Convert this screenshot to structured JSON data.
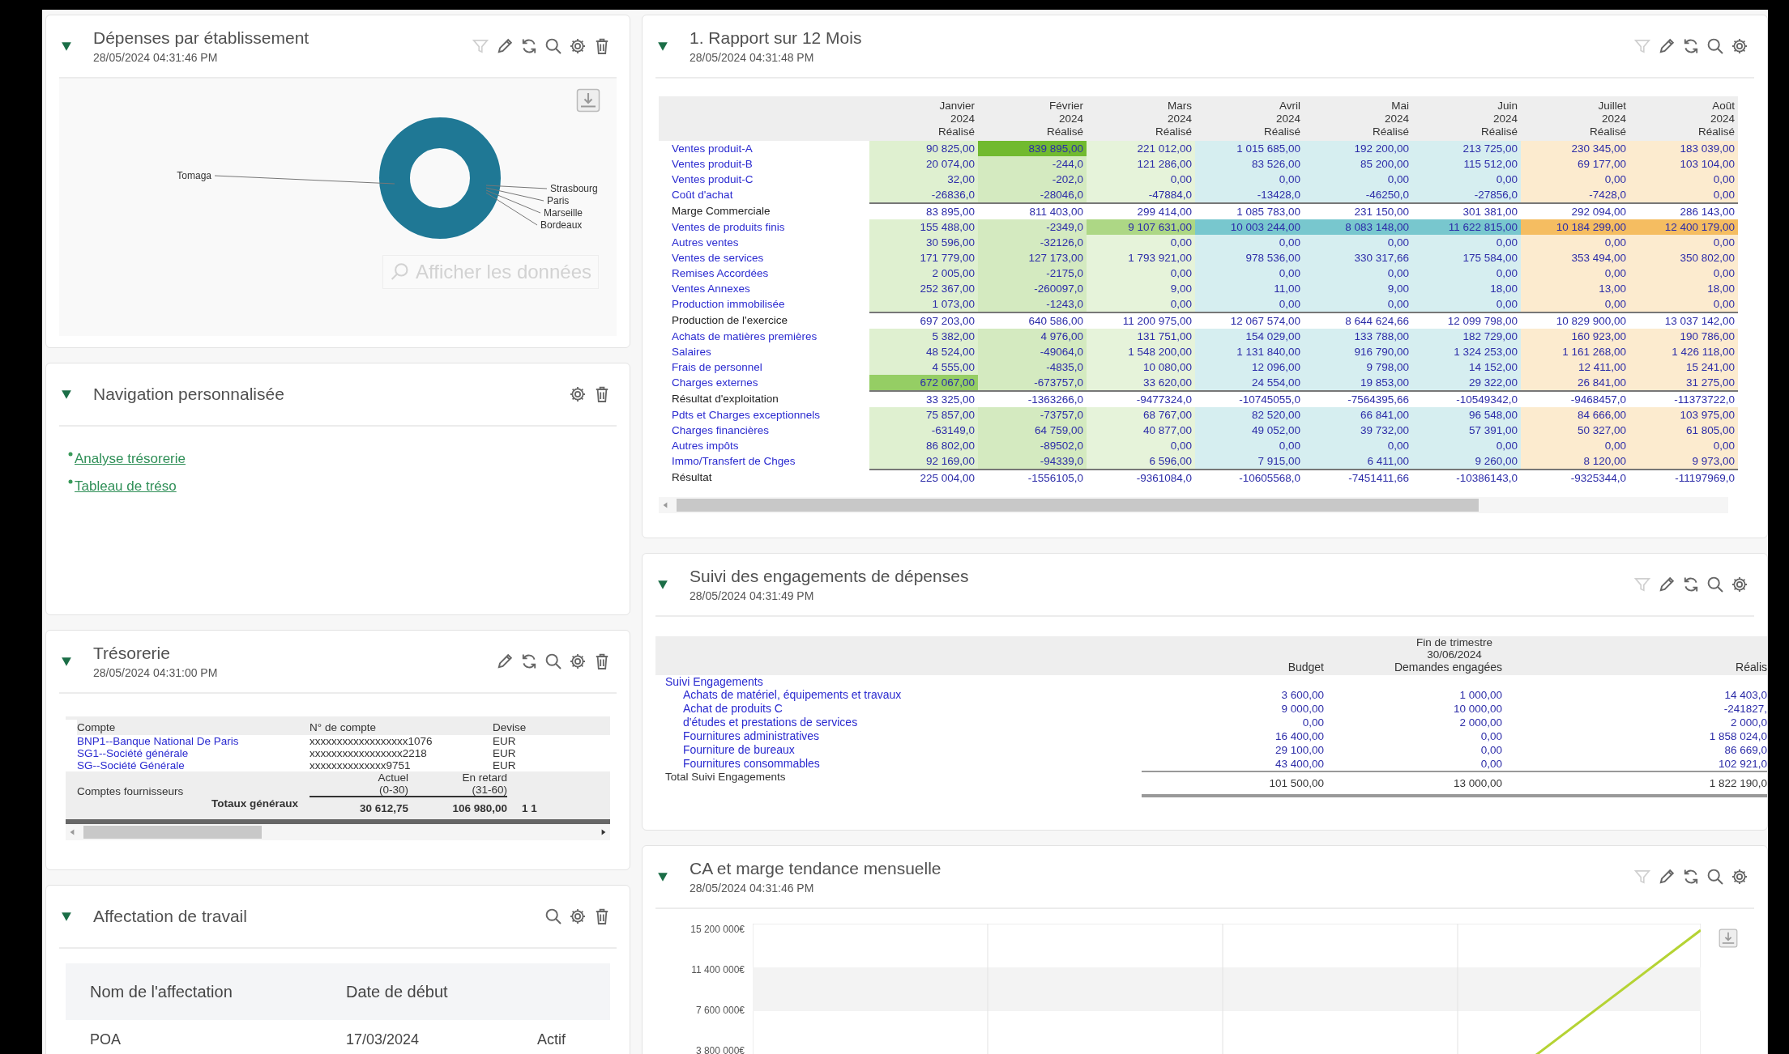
{
  "left": {
    "expenses": {
      "title": "Dépenses par établissement",
      "date": "28/05/2024 04:31:46 PM",
      "tools": [
        {
          "kind": "filter",
          "disabled": true
        },
        {
          "kind": "edit",
          "disabled": false
        },
        {
          "kind": "refresh",
          "disabled": false
        },
        {
          "kind": "search",
          "disabled": false
        },
        {
          "kind": "settings",
          "disabled": false
        },
        {
          "kind": "delete",
          "disabled": false
        }
      ],
      "donut_left_label": "Tomaga",
      "donut_right_labels": [
        "Strasbourg",
        "Paris",
        "Marseille",
        "Bordeaux"
      ],
      "show_data_button": {
        "label": "Afficher les données",
        "disabled": true
      }
    },
    "navigation": {
      "title": "Navigation personnalisée",
      "tools": [
        {
          "kind": "settings",
          "disabled": false
        },
        {
          "kind": "delete",
          "disabled": false
        }
      ],
      "links": [
        "Analyse trésorerie",
        "Tableau de tréso"
      ]
    },
    "treasury": {
      "title": "Trésorerie",
      "date": "28/05/2024 04:31:00 PM",
      "tools": [
        {
          "kind": "edit",
          "disabled": false
        },
        {
          "kind": "refresh",
          "disabled": false
        },
        {
          "kind": "search",
          "disabled": false
        },
        {
          "kind": "settings",
          "disabled": false
        },
        {
          "kind": "delete",
          "disabled": false
        }
      ],
      "columns": [
        "Compte",
        "N° de compte",
        "Devise"
      ],
      "rows": [
        {
          "account": "BNP1--Banque National De Paris",
          "number": "xxxxxxxxxxxxxxxxxx1076",
          "currency": "EUR"
        },
        {
          "account": "SG1--Société générale",
          "number": "xxxxxxxxxxxxxxxxx2218",
          "currency": "EUR"
        },
        {
          "account": "SG--Société Générale",
          "number": "xxxxxxxxxxxxxx9751",
          "currency": "EUR"
        }
      ],
      "suppliers_label": "Comptes fournisseurs",
      "aging_columns": [
        {
          "label": "Actuel",
          "range": "(0-30)"
        },
        {
          "label": "En retard",
          "range": "(31-60)"
        }
      ],
      "totals_label": "Totaux généraux",
      "totals": [
        "30 612,75",
        "106 980,00",
        "1 1"
      ]
    },
    "assignment": {
      "title": "Affectation de travail",
      "tools": [
        {
          "kind": "search",
          "disabled": false
        },
        {
          "kind": "settings",
          "disabled": false
        },
        {
          "kind": "delete",
          "disabled": false
        }
      ],
      "columns": [
        "Nom de l'affectation",
        "Date de début"
      ],
      "rows": [
        {
          "name": "POA",
          "start": "17/03/2024",
          "status": "Actif"
        }
      ]
    }
  },
  "right": {
    "report": {
      "title": "1. Rapport sur 12 Mois",
      "date": "28/05/2024 04:31:48 PM",
      "tools": [
        {
          "kind": "filter",
          "disabled": true
        },
        {
          "kind": "edit",
          "disabled": false
        },
        {
          "kind": "refresh",
          "disabled": false
        },
        {
          "kind": "search",
          "disabled": false
        },
        {
          "kind": "settings",
          "disabled": false
        }
      ],
      "columns": [
        {
          "month": "Janvier",
          "year": "2024",
          "measure": "Réalisé",
          "color": "#dff0d0"
        },
        {
          "month": "Février",
          "year": "2024",
          "measure": "Réalisé",
          "color": "#d4eac0"
        },
        {
          "month": "Mars",
          "year": "2024",
          "measure": "Réalisé",
          "color": "#e6f3da"
        },
        {
          "month": "Avril",
          "year": "2024",
          "measure": "Réalisé",
          "color": "#d6eef0"
        },
        {
          "month": "Mai",
          "year": "2024",
          "measure": "Réalisé",
          "color": "#d6eef0"
        },
        {
          "month": "Juin",
          "year": "2024",
          "measure": "Réalisé",
          "color": "#d6eef0"
        },
        {
          "month": "Juillet",
          "year": "2024",
          "measure": "Réalisé",
          "color": "#fcebcf"
        },
        {
          "month": "Août",
          "year": "2024",
          "measure": "Réalisé",
          "color": "#fcebcf"
        }
      ],
      "rows": [
        {
          "label": "Ventes produit-A",
          "kind": "detail",
          "values": [
            "90 825,00",
            "839 895,00",
            "221 012,00",
            "1 015 685,00",
            "192 200,00",
            "213 725,00",
            "230 345,00",
            "183 039,00"
          ],
          "highlight": [
            false,
            true,
            false,
            false,
            false,
            false,
            false,
            false
          ]
        },
        {
          "label": "Ventes produit-B",
          "kind": "detail",
          "values": [
            "20 074,00",
            "-244,0",
            "121 286,00",
            "83 526,00",
            "85 200,00",
            "115 512,00",
            "69 177,00",
            "103 104,00"
          ],
          "highlight": [
            false,
            false,
            false,
            false,
            false,
            false,
            false,
            false
          ]
        },
        {
          "label": "Ventes produit-C",
          "kind": "detail",
          "values": [
            "32,00",
            "-202,0",
            "0,00",
            "0,00",
            "0,00",
            "0,00",
            "0,00",
            "0,00"
          ],
          "highlight": [
            false,
            false,
            false,
            false,
            false,
            false,
            false,
            false
          ]
        },
        {
          "label": "Coût d'achat",
          "kind": "detail",
          "values": [
            "-26836,0",
            "-28046,0",
            "-47884,0",
            "-13428,0",
            "-46250,0",
            "-27856,0",
            "-7428,0",
            "0,00"
          ],
          "highlight": [
            false,
            false,
            false,
            false,
            false,
            false,
            false,
            false
          ]
        },
        {
          "label": "Marge Commerciale",
          "kind": "total",
          "values": [
            "83 895,00",
            "811 403,00",
            "299 414,00",
            "1 085 783,00",
            "231 150,00",
            "301 381,00",
            "292 094,00",
            "286 143,00"
          ],
          "highlight": [
            false,
            false,
            false,
            false,
            false,
            false,
            false,
            false
          ]
        },
        {
          "label": "Ventes de produits finis",
          "kind": "detail",
          "values": [
            "155 488,00",
            "-2349,0",
            "9 107 631,00",
            "10 003 244,00",
            "8 083 148,00",
            "11 622 815,00",
            "10 184 299,00",
            "12 400 179,00"
          ],
          "highlight": [
            false,
            false,
            true,
            true,
            true,
            true,
            true,
            true
          ]
        },
        {
          "label": "Autres ventes",
          "kind": "detail",
          "values": [
            "30 596,00",
            "-32126,0",
            "0,00",
            "0,00",
            "0,00",
            "0,00",
            "0,00",
            "0,00"
          ],
          "highlight": [
            false,
            false,
            false,
            false,
            false,
            false,
            false,
            false
          ]
        },
        {
          "label": "Ventes de services",
          "kind": "detail",
          "values": [
            "171 779,00",
            "127 173,00",
            "1 793 921,00",
            "978 536,00",
            "330 317,66",
            "175 584,00",
            "353 494,00",
            "350 802,00"
          ],
          "highlight": [
            false,
            false,
            false,
            false,
            false,
            false,
            false,
            false
          ]
        },
        {
          "label": "Remises Accordées",
          "kind": "detail",
          "values": [
            "2 005,00",
            "-2175,0",
            "0,00",
            "0,00",
            "0,00",
            "0,00",
            "0,00",
            "0,00"
          ],
          "highlight": [
            false,
            false,
            false,
            false,
            false,
            false,
            false,
            false
          ]
        },
        {
          "label": "Ventes Annexes",
          "kind": "detail",
          "values": [
            "252 367,00",
            "-260097,0",
            "9,00",
            "11,00",
            "9,00",
            "18,00",
            "13,00",
            "18,00"
          ],
          "highlight": [
            false,
            false,
            false,
            false,
            false,
            false,
            false,
            false
          ]
        },
        {
          "label": "Production immobilisée",
          "kind": "detail",
          "values": [
            "1 073,00",
            "-1243,0",
            "0,00",
            "0,00",
            "0,00",
            "0,00",
            "0,00",
            "0,00"
          ],
          "highlight": [
            false,
            false,
            false,
            false,
            false,
            false,
            false,
            false
          ]
        },
        {
          "label": "Production de l'exercice",
          "kind": "total",
          "values": [
            "697 203,00",
            "640 586,00",
            "11 200 975,00",
            "12 067 574,00",
            "8 644 624,66",
            "12 099 798,00",
            "10 829 900,00",
            "13 037 142,00"
          ],
          "highlight": [
            false,
            false,
            false,
            false,
            false,
            false,
            false,
            false
          ]
        },
        {
          "label": "Achats de matières premières",
          "kind": "detail",
          "values": [
            "5 382,00",
            "4 976,00",
            "131 751,00",
            "154 029,00",
            "133 788,00",
            "182 729,00",
            "160 923,00",
            "190 786,00"
          ],
          "highlight": [
            false,
            false,
            false,
            false,
            false,
            false,
            false,
            false
          ]
        },
        {
          "label": "Salaires",
          "kind": "detail",
          "values": [
            "48 524,00",
            "-49064,0",
            "1 548 200,00",
            "1 131 840,00",
            "916 790,00",
            "1 324 253,00",
            "1 161 268,00",
            "1 426 118,00"
          ],
          "highlight": [
            false,
            false,
            false,
            false,
            false,
            false,
            false,
            false
          ]
        },
        {
          "label": "Frais de personnel",
          "kind": "detail",
          "values": [
            "4 555,00",
            "-4835,0",
            "10 080,00",
            "12 096,00",
            "9 798,00",
            "14 152,00",
            "12 411,00",
            "15 241,00"
          ],
          "highlight": [
            false,
            false,
            false,
            false,
            false,
            false,
            false,
            false
          ]
        },
        {
          "label": "Charges externes",
          "kind": "detail",
          "values": [
            "672 067,00",
            "-673757,0",
            "33 620,00",
            "24 554,00",
            "19 853,00",
            "29 322,00",
            "26 841,00",
            "31 275,00"
          ],
          "highlight": [
            true,
            false,
            false,
            false,
            false,
            false,
            false,
            false
          ]
        },
        {
          "label": "Résultat d'exploitation",
          "kind": "total",
          "values": [
            "33 325,00",
            "-1363266,0",
            "-9477324,0",
            "-10745055,0",
            "-7564395,66",
            "-10549342,0",
            "-9468457,0",
            "-11373722,0"
          ],
          "highlight": [
            false,
            false,
            false,
            false,
            false,
            false,
            false,
            false
          ]
        },
        {
          "label": "Pdts et Charges exceptionnels",
          "kind": "detail",
          "values": [
            "75 857,00",
            "-73757,0",
            "68 767,00",
            "82 520,00",
            "66 841,00",
            "96 548,00",
            "84 666,00",
            "103 975,00"
          ],
          "highlight": [
            false,
            false,
            false,
            false,
            false,
            false,
            false,
            false
          ]
        },
        {
          "label": "Charges financières",
          "kind": "detail",
          "values": [
            "-63149,0",
            "64 759,00",
            "40 877,00",
            "49 052,00",
            "39 732,00",
            "57 391,00",
            "50 327,00",
            "61 805,00"
          ],
          "highlight": [
            false,
            false,
            false,
            false,
            false,
            false,
            false,
            false
          ]
        },
        {
          "label": "Autres impôts",
          "kind": "detail",
          "values": [
            "86 802,00",
            "-89502,0",
            "0,00",
            "0,00",
            "0,00",
            "0,00",
            "0,00",
            "0,00"
          ],
          "highlight": [
            false,
            false,
            false,
            false,
            false,
            false,
            false,
            false
          ]
        },
        {
          "label": "Immo/Transfert de Chges",
          "kind": "detail",
          "values": [
            "92 169,00",
            "-94339,0",
            "6 596,00",
            "7 915,00",
            "6 411,00",
            "9 260,00",
            "8 120,00",
            "9 973,00"
          ],
          "highlight": [
            false,
            false,
            false,
            false,
            false,
            false,
            false,
            false
          ]
        },
        {
          "label": "Résultat",
          "kind": "total",
          "values": [
            "225 004,00",
            "-1556105,0",
            "-9361084,0",
            "-10605568,0",
            "-7451411,66",
            "-10386143,0",
            "-9325344,0",
            "-11197969,0"
          ],
          "highlight": [
            false,
            false,
            false,
            false,
            false,
            false,
            false,
            false
          ]
        }
      ]
    },
    "commitments": {
      "title": "Suivi des engagements de dépenses",
      "date": "28/05/2024 04:31:49 PM",
      "tools": [
        {
          "kind": "filter",
          "disabled": true
        },
        {
          "kind": "edit",
          "disabled": false
        },
        {
          "kind": "refresh",
          "disabled": false
        },
        {
          "kind": "search",
          "disabled": false
        },
        {
          "kind": "settings",
          "disabled": false
        }
      ],
      "period": "Fin de trimestre",
      "period_date": "30/06/2024",
      "columns": [
        "Budget",
        "Demandes engagées",
        "Réalis"
      ],
      "group": "Suivi Engagements",
      "rows": [
        {
          "label": "Achats de matériel, équipements et travaux",
          "values": [
            "3 600,00",
            "1 000,00",
            "14 403,0"
          ]
        },
        {
          "label": "Achat de produits C",
          "values": [
            "9 000,00",
            "10 000,00",
            "-241827,"
          ]
        },
        {
          "label": "d'études et prestations de services",
          "values": [
            "0,00",
            "2 000,00",
            "2 000,0"
          ]
        },
        {
          "label": "Fournitures administratives",
          "values": [
            "16 400,00",
            "0,00",
            "1 858 024,0"
          ]
        },
        {
          "label": "Fourniture de bureaux",
          "values": [
            "29 100,00",
            "0,00",
            "86 669,0"
          ]
        },
        {
          "label": "Fournitures consommables",
          "values": [
            "43 400,00",
            "0,00",
            "102 921,0"
          ]
        }
      ],
      "total": {
        "label": "Total Suivi Engagements",
        "values": [
          "101 500,00",
          "13 000,00",
          "1 822 190,0"
        ]
      }
    },
    "trend": {
      "title": "CA et marge tendance mensuelle",
      "date": "28/05/2024 04:31:46 PM",
      "tools": [
        {
          "kind": "filter",
          "disabled": true
        },
        {
          "kind": "edit",
          "disabled": false
        },
        {
          "kind": "refresh",
          "disabled": false
        },
        {
          "kind": "search",
          "disabled": false
        },
        {
          "kind": "settings",
          "disabled": false
        }
      ],
      "y_ticks": [
        "15 200 000€",
        "11 400 000€",
        "7 600 000€",
        "3 800 000€"
      ]
    }
  }
}
